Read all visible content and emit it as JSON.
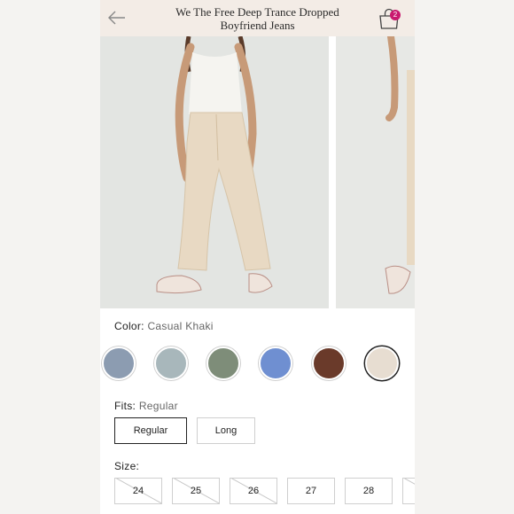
{
  "header": {
    "title_line1": "We The Free Deep Trance Dropped",
    "title_line2": "Boyfriend Jeans",
    "cart_count": "2"
  },
  "product": {
    "color_label": "Color:",
    "color_value": "Casual Khaki",
    "swatches": [
      {
        "name": "light-wash-denim",
        "color": "#8c9cb1"
      },
      {
        "name": "light-blue-denim",
        "color": "#a8b7bb"
      },
      {
        "name": "olive-green",
        "color": "#7e8d79"
      },
      {
        "name": "bright-blue-denim",
        "color": "#6f8fd1"
      },
      {
        "name": "brown",
        "color": "#6a3a2a"
      },
      {
        "name": "casual-khaki",
        "color": "#e7ddd1"
      }
    ],
    "fits_label": "Fits:",
    "fits_value": "Regular",
    "fit_options": [
      "Regular",
      "Long"
    ],
    "size_label": "Size:",
    "sizes": [
      {
        "label": "24",
        "available": false
      },
      {
        "label": "25",
        "available": false
      },
      {
        "label": "26",
        "available": false
      },
      {
        "label": "27",
        "available": true
      },
      {
        "label": "28",
        "available": true
      }
    ]
  }
}
